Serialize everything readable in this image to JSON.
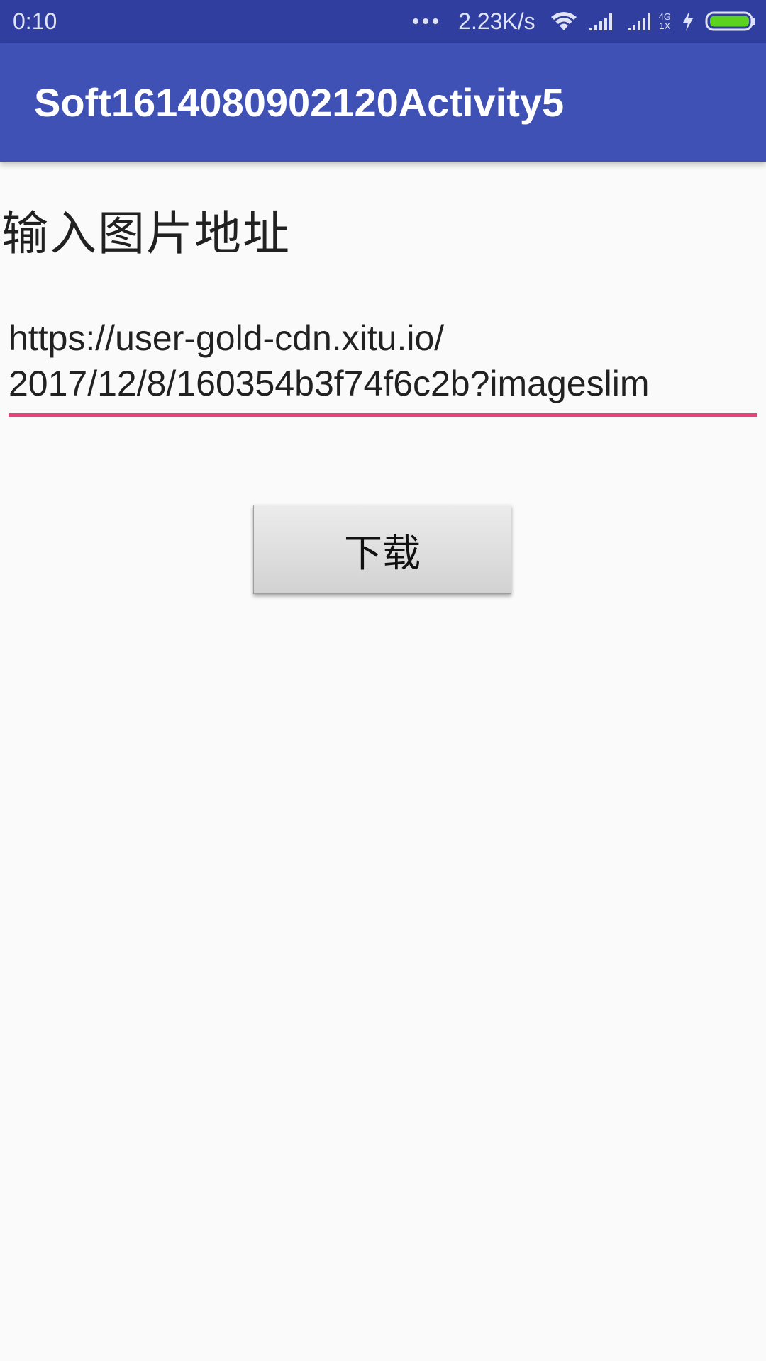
{
  "status_bar": {
    "time": "0:10",
    "network_speed": "2.23K/s",
    "network_type": "4G",
    "network_sub": "1X",
    "icons": [
      "more-dots-icon",
      "wifi-icon",
      "signal-icon",
      "signal-4g-icon",
      "charging-bolt-icon",
      "battery-icon"
    ],
    "colors": {
      "background": "#303f9f",
      "battery_fill": "#5bd21e"
    }
  },
  "app_bar": {
    "title": "Soft1614080902120Activity5",
    "color": "#3f51b5"
  },
  "main": {
    "label": "输入图片地址",
    "url_input": {
      "value": "https://user-gold-cdn.xitu.io/\n2017/12/8/160354b3f74f6c2b?imageslim",
      "underline_color": "#e91e63"
    },
    "download_button": {
      "label": "下载"
    }
  }
}
